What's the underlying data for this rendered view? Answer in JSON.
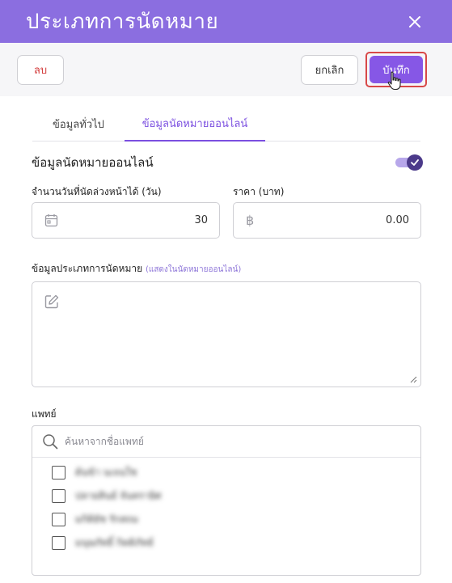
{
  "header": {
    "title": "ประเภทการนัดหมาย",
    "close_icon": "close-icon"
  },
  "toolbar": {
    "delete_label": "ลบ",
    "cancel_label": "ยกเลิก",
    "save_label": "บันทึก"
  },
  "tabs": [
    {
      "label": "ข้อมูลทั่วไป",
      "active": false
    },
    {
      "label": "ข้อมูลนัดหมายออนไลน์",
      "active": true
    }
  ],
  "online": {
    "section_title": "ข้อมูลนัดหมายออนไลน์",
    "toggle_on": true,
    "advance_days_label": "จำนวนวันที่นัดล่วงหน้าได้ (วัน)",
    "advance_days_value": "30",
    "price_label": "ราคา (บาท)",
    "price_value": "0.00",
    "currency_symbol": "฿",
    "description_label": "ข้อมูลประเภทการนัดหมาย",
    "description_hint": "(แสดงในนัดหมายออนไลน์)",
    "description_value": ""
  },
  "doctors": {
    "label": "แพทย์",
    "search_placeholder": "ค้นหาจากชื่อแพทย์",
    "items": [
      {
        "name": "ต้นข้า นเจนใช",
        "checked": false
      },
      {
        "name": "ปลายสินธ์ จันทรายิศ",
        "checked": false
      },
      {
        "name": "มกิติยัช รักสถม",
        "checked": false
      },
      {
        "name": "มนุษภัทธิ์ กิตติภัทธ์",
        "checked": false
      }
    ]
  },
  "colors": {
    "header": "#8b6ee0",
    "accent": "#7b4fe0",
    "save": "#8657e6",
    "delete_text": "#d33a3a",
    "highlight": "#d84848"
  }
}
